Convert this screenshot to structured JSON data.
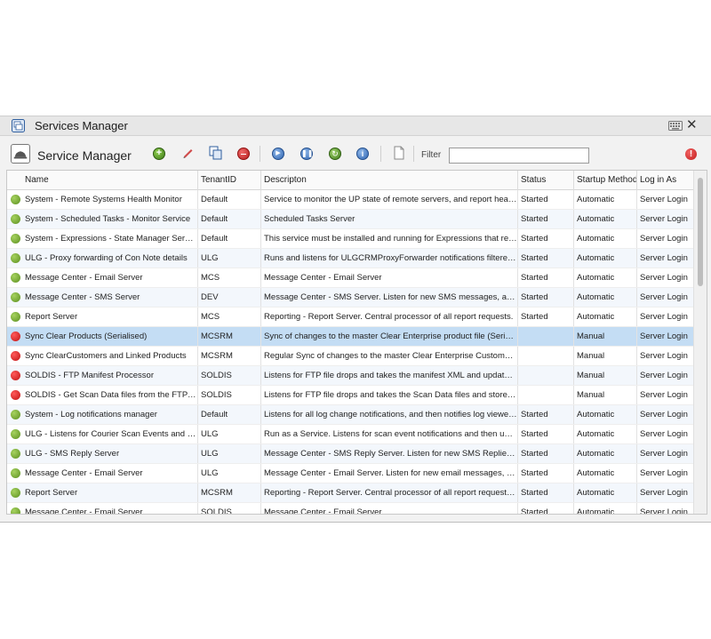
{
  "window": {
    "title": "Services Manager"
  },
  "toolbar": {
    "title": "Service Manager",
    "filter_label": "Filter",
    "filter_value": "",
    "colors": {
      "add": "#5a9a2a",
      "edit": "#d04040",
      "delete": "#d52a2a",
      "action": "#3f7fc6",
      "refresh": "#4a8f2a",
      "alert": "#d31f1f"
    }
  },
  "grid": {
    "columns": [
      "Name",
      "TenantID",
      "Descripton",
      "Status",
      "Startup Method",
      "Log in As"
    ],
    "rows": [
      {
        "status_icon": "green",
        "name": "System - Remote Systems Health Monitor",
        "tenant": "Default",
        "description": "Service to monitor the UP state of remote servers, and report heartbe...",
        "status": "Started",
        "startup": "Automatic",
        "login": "Server Login"
      },
      {
        "status_icon": "green",
        "name": "System - Scheduled Tasks - Monitor Service",
        "tenant": "Default",
        "description": "Scheduled Tasks Server",
        "status": "Started",
        "startup": "Automatic",
        "login": "Server Login"
      },
      {
        "status_icon": "green",
        "name": "System - Expressions - State Manager Service",
        "tenant": "Default",
        "description": "This service must be installed and running for Expressions that requir...",
        "status": "Started",
        "startup": "Automatic",
        "login": "Server Login"
      },
      {
        "status_icon": "green",
        "name": "ULG - Proxy forwarding of Con Note details",
        "tenant": "ULG",
        "description": "Runs and listens for ULGCRMProxyForwarder notifications filtered by ...",
        "status": "Started",
        "startup": "Automatic",
        "login": "Server Login"
      },
      {
        "status_icon": "green",
        "name": "Message Center - Email Server",
        "tenant": "MCS",
        "description": "Message Center - Email Server",
        "status": "Started",
        "startup": "Automatic",
        "login": "Server Login"
      },
      {
        "status_icon": "green",
        "name": "Message Center - SMS Server",
        "tenant": "DEV",
        "description": "Message Center - SMS Server. Listen for new SMS messages, and send...",
        "status": "Started",
        "startup": "Automatic",
        "login": "Server Login"
      },
      {
        "status_icon": "green",
        "name": "Report Server",
        "tenant": "MCS",
        "description": "Reporting - Report Server. Central processor of all report requests.",
        "status": "Started",
        "startup": "Automatic",
        "login": "Server Login"
      },
      {
        "status_icon": "red",
        "name": "Sync Clear Products (Serialised)",
        "tenant": "MCSRM",
        "description": "Sync of changes to the master Clear Enterprise product file (Serialised...",
        "status": "",
        "startup": "Manual",
        "login": "Server Login",
        "selected": true
      },
      {
        "status_icon": "red",
        "name": "Sync ClearCustomers and Linked Products",
        "tenant": "MCSRM",
        "description": "Regular Sync of changes to the master Clear Enterprise Customers an...",
        "status": "",
        "startup": "Manual",
        "login": "Server Login"
      },
      {
        "status_icon": "red",
        "name": "SOLDIS - FTP Manifest Processor",
        "tenant": "SOLDIS",
        "description": "Listens for FTP file drops and takes the manifest XML and updates Ne...",
        "status": "",
        "startup": "Manual",
        "login": "Server Login"
      },
      {
        "status_icon": "red",
        "name": "SOLDIS - Get Scan Data files from the FTP serv...",
        "tenant": "SOLDIS",
        "description": "Listens for FTP file drops and takes the Scan Data files and stores the...",
        "status": "",
        "startup": "Manual",
        "login": "Server Login"
      },
      {
        "status_icon": "green",
        "name": "System - Log notifications manager",
        "tenant": "Default",
        "description": "Listens for all log change notifications, and then notifies log viewers i...",
        "status": "Started",
        "startup": "Automatic",
        "login": "Server Login"
      },
      {
        "status_icon": "green",
        "name": "ULG - Listens for Courier Scan Events and upda...",
        "tenant": "ULG",
        "description": "Run as a Service. Listens for scan event notifications and then update...",
        "status": "Started",
        "startup": "Automatic",
        "login": "Server Login"
      },
      {
        "status_icon": "green",
        "name": "ULG - SMS Reply Server",
        "tenant": "ULG",
        "description": "Message Center - SMS Reply Server. Listen for new SMS Replies and d...",
        "status": "Started",
        "startup": "Automatic",
        "login": "Server Login"
      },
      {
        "status_icon": "green",
        "name": "Message Center - Email Server",
        "tenant": "ULG",
        "description": "Message Center - Email Server. Listen for new email messages, and se...",
        "status": "Started",
        "startup": "Automatic",
        "login": "Server Login"
      },
      {
        "status_icon": "green",
        "name": "Report Server",
        "tenant": "MCSRM",
        "description": "Reporting - Report Server. Central processor of all report requests. Not...",
        "status": "Started",
        "startup": "Automatic",
        "login": "Server Login"
      },
      {
        "status_icon": "green",
        "name": "Message Center - Email Server",
        "tenant": "SOLDIS",
        "description": "Message Center - Email Server.",
        "status": "Started",
        "startup": "Automatic",
        "login": "Server Login"
      }
    ]
  }
}
